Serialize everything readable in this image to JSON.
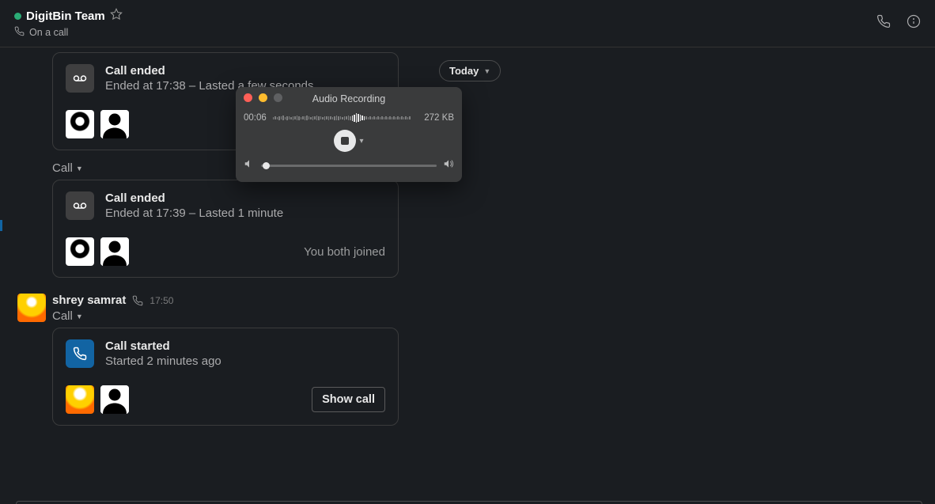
{
  "header": {
    "title": "DigitBin Team",
    "subline": "On a call"
  },
  "today_label": "Today",
  "calls": [
    {
      "title": "Call ended",
      "detail": "Ended at 17:38 – Lasted a few seconds",
      "foot_text": "",
      "show_button": false,
      "icon_bg": "grey",
      "icon": "voicemail",
      "avatars": [
        "bw",
        "user"
      ]
    },
    {
      "title": "Call ended",
      "detail": "Ended at 17:39 – Lasted 1 minute",
      "foot_text": "You both joined",
      "show_button": false,
      "icon_bg": "grey",
      "icon": "voicemail",
      "avatars": [
        "bw",
        "user"
      ]
    },
    {
      "title": "Call started",
      "detail": "Started 2 minutes ago",
      "foot_text": "",
      "show_button": true,
      "button_label": "Show call",
      "icon_bg": "blue",
      "icon": "phone",
      "avatars": [
        "flame",
        "user"
      ]
    }
  ],
  "call_label": "Call",
  "message": {
    "author": "shrey samrat",
    "time": "17:50"
  },
  "audio_recording": {
    "title": "Audio Recording",
    "elapsed": "00:06",
    "size": "272 KB"
  }
}
